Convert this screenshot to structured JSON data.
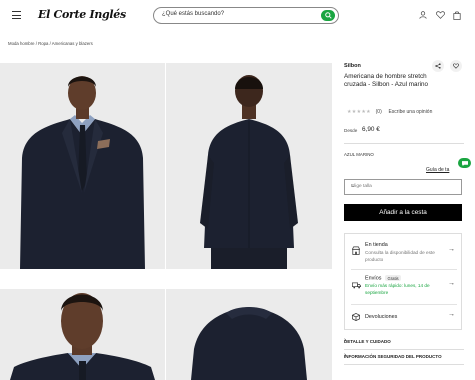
{
  "header": {
    "logo": "El Corte Inglés",
    "search_placeholder": "¿Qué estás buscando?",
    "icons": [
      "menu-icon",
      "search-icon",
      "user-icon",
      "heart-icon",
      "bag-icon"
    ]
  },
  "breadcrumb": [
    "Moda hombre",
    "Ropa",
    "Americanas y blazers"
  ],
  "product": {
    "brand": "Silbon",
    "title": "Americana de hombre stretch cruzada - Silbon - Azul marino",
    "stars": "★★★★★",
    "rating_count": "(0)",
    "write_review": "Escribe una opinión",
    "price_prefix": "Desde",
    "price": "6,90 €",
    "color_name": "AZUL MARINO",
    "size_guide": "Guía de ta",
    "size_placeholder": "Elige talla",
    "add_to_cart": "Añadir a la cesta"
  },
  "delivery": {
    "store_title": "En tienda",
    "store_sub": "Consulta la disponibilidad de este producto",
    "shipping_title": "Envíos",
    "shipping_badge": "Gratis",
    "shipping_sub": "Envío más rápido: lunes, 14 de septiembre",
    "returns_title": "Devoluciones"
  },
  "accordions": {
    "details": "DETALLE Y CUIDADO",
    "safety": "INFORMACIÓN SEGURIDAD DEL PRODUCTO"
  },
  "colors": {
    "accent_green": "#1aa541",
    "suit_navy": "#1c2130",
    "photo_bg": "#ebebeb"
  }
}
